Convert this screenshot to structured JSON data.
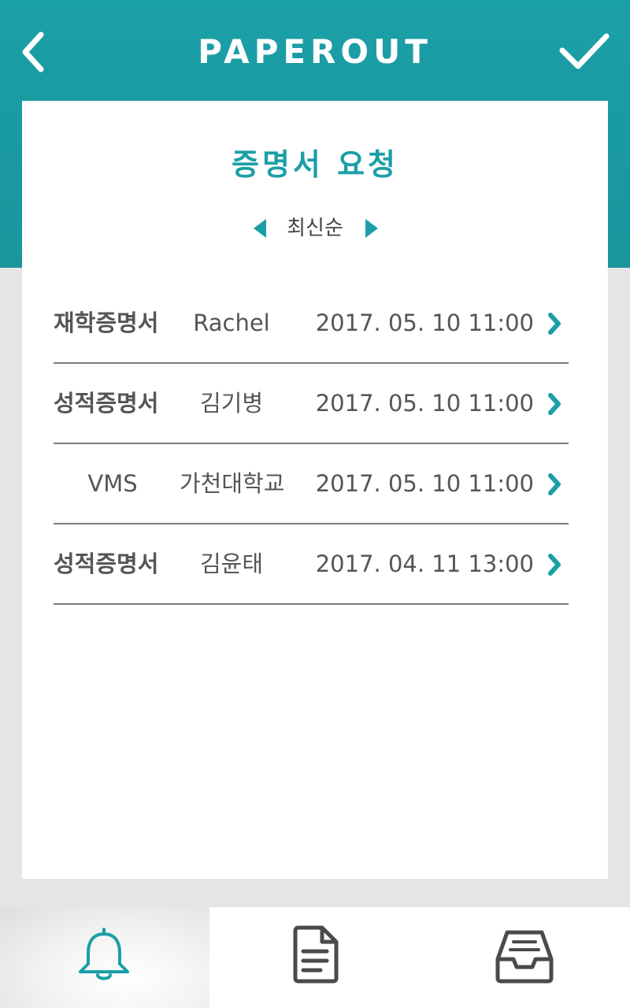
{
  "app": {
    "title": "PAPEROUT"
  },
  "header": {
    "back_icon": "chevron-left-icon",
    "confirm_icon": "checkmark-icon"
  },
  "card": {
    "title": "증명서 요청"
  },
  "sort": {
    "label": "최신순",
    "prev_icon": "triangle-left-icon",
    "next_icon": "triangle-right-icon"
  },
  "requests": [
    {
      "type": "재학증명서",
      "name": "Rachel",
      "datetime": "2017. 05. 10 11:00"
    },
    {
      "type": "성적증명서",
      "name": "김기병",
      "datetime": "2017. 05. 10 11:00"
    },
    {
      "type": "VMS",
      "name": "가천대학교",
      "datetime": "2017. 05. 10 11:00"
    },
    {
      "type": "성적증명서",
      "name": "김윤태",
      "datetime": "2017. 04. 11 13:00"
    }
  ],
  "bottom_nav": [
    {
      "icon": "bell-icon",
      "active": true
    },
    {
      "icon": "document-icon",
      "active": false
    },
    {
      "icon": "inbox-tray-icon",
      "active": false
    }
  ],
  "colors": {
    "accent": "#1b9fa7",
    "divider": "#7d7d7d",
    "text": "#555555",
    "background": "#e5e5e5"
  }
}
